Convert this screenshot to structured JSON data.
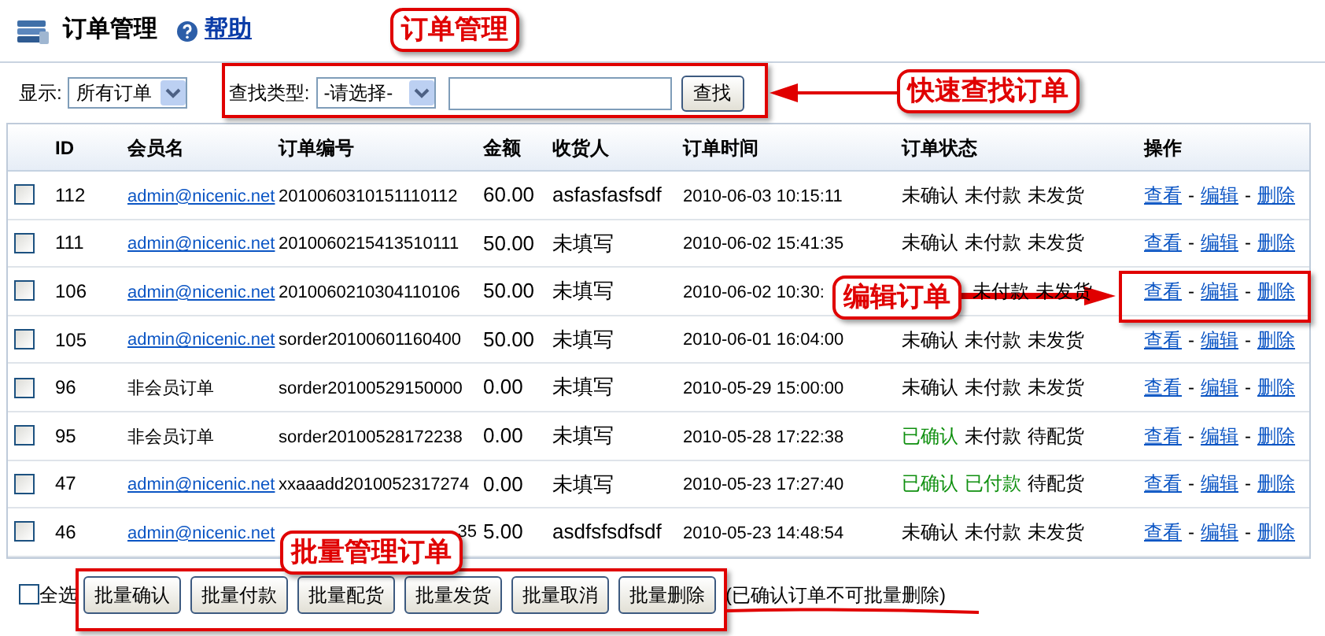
{
  "header": {
    "title": "订单管理",
    "help": "帮助"
  },
  "filter": {
    "label": "显示:",
    "value": "所有订单"
  },
  "search": {
    "type_label": "查找类型:",
    "type_value": "-请选择-",
    "button": "查找"
  },
  "table": {
    "columns": [
      "ID",
      "会员名",
      "订单编号",
      "金额",
      "收货人",
      "订单时间",
      "订单状态",
      "操作"
    ],
    "rows": [
      {
        "checked": false,
        "id": "112",
        "member": "admin@nicenic.net",
        "member_link": true,
        "order_no": "2010060310151110112",
        "amount": "60.00",
        "consignee": "asfasfasfsdf",
        "time": "2010-06-03 10:15:11",
        "status": [
          {
            "text": "未确认",
            "done": false
          },
          {
            "text": "未付款",
            "done": false
          },
          {
            "text": "未发货",
            "done": false
          }
        ],
        "actions": [
          {
            "kind": "link",
            "text": "查看"
          },
          {
            "kind": "sep",
            "text": "-"
          },
          {
            "kind": "link",
            "text": "编辑"
          },
          {
            "kind": "sep",
            "text": "-"
          },
          {
            "kind": "link",
            "text": "删除"
          }
        ]
      },
      {
        "checked": false,
        "id": "111",
        "member": "admin@nicenic.net",
        "member_link": true,
        "order_no": "2010060215413510111",
        "amount": "50.00",
        "consignee": "未填写",
        "time": "2010-06-02 15:41:35",
        "status": [
          {
            "text": "未确认",
            "done": false
          },
          {
            "text": "未付款",
            "done": false
          },
          {
            "text": "未发货",
            "done": false
          }
        ],
        "actions": [
          {
            "kind": "link",
            "text": "查看"
          },
          {
            "kind": "sep",
            "text": "-"
          },
          {
            "kind": "link",
            "text": "编辑"
          },
          {
            "kind": "sep",
            "text": "-"
          },
          {
            "kind": "link",
            "text": "删除"
          }
        ]
      },
      {
        "checked": false,
        "id": "106",
        "member": "admin@nicenic.net",
        "member_link": true,
        "order_no": "2010060210304110106",
        "amount": "50.00",
        "consignee": "未填写",
        "time": "2010-06-02 10:30:",
        "status": [
          {
            "text": "未付款",
            "done": false
          },
          {
            "text": "未发货",
            "done": false
          }
        ],
        "actions": [
          {
            "kind": "link",
            "text": "查看"
          },
          {
            "kind": "sep",
            "text": "-"
          },
          {
            "kind": "link",
            "text": "编辑"
          },
          {
            "kind": "sep",
            "text": "-"
          },
          {
            "kind": "link",
            "text": "删除"
          }
        ]
      },
      {
        "checked": false,
        "id": "105",
        "member": "admin@nicenic.net",
        "member_link": true,
        "order_no": "sorder20100601160400",
        "amount": "50.00",
        "consignee": "未填写",
        "time": "2010-06-01 16:04:00",
        "status": [
          {
            "text": "未确认",
            "done": false
          },
          {
            "text": "未付款",
            "done": false
          },
          {
            "text": "未发货",
            "done": false
          }
        ],
        "actions": [
          {
            "kind": "link",
            "text": "查看"
          },
          {
            "kind": "sep",
            "text": "-"
          },
          {
            "kind": "link",
            "text": "编辑"
          },
          {
            "kind": "sep",
            "text": "-"
          },
          {
            "kind": "link",
            "text": "删除"
          }
        ]
      },
      {
        "checked": false,
        "id": "96",
        "member": "非会员订单",
        "member_link": false,
        "order_no": "sorder20100529150000",
        "amount": "0.00",
        "consignee": "未填写",
        "time": "2010-05-29 15:00:00",
        "status": [
          {
            "text": "未确认",
            "done": false
          },
          {
            "text": "未付款",
            "done": false
          },
          {
            "text": "未发货",
            "done": false
          }
        ],
        "actions": [
          {
            "kind": "link",
            "text": "查看"
          },
          {
            "kind": "sep",
            "text": "-"
          },
          {
            "kind": "link",
            "text": "编辑"
          },
          {
            "kind": "sep",
            "text": "-"
          },
          {
            "kind": "link",
            "text": "删除"
          }
        ]
      },
      {
        "checked": false,
        "id": "95",
        "member": "非会员订单",
        "member_link": false,
        "order_no": "sorder20100528172238",
        "amount": "0.00",
        "consignee": "未填写",
        "time": "2010-05-28 17:22:38",
        "status": [
          {
            "text": "已确认",
            "done": true
          },
          {
            "text": "未付款",
            "done": false
          },
          {
            "text": "待配货",
            "done": false
          }
        ],
        "actions": [
          {
            "kind": "link",
            "text": "查看"
          },
          {
            "kind": "sep",
            "text": "-"
          },
          {
            "kind": "link",
            "text": "编辑"
          },
          {
            "kind": "sep",
            "text": "-"
          },
          {
            "kind": "link",
            "text": "删除"
          }
        ]
      },
      {
        "checked": false,
        "id": "47",
        "member": "admin@nicenic.net",
        "member_link": true,
        "order_no": "xxaaadd2010052317274",
        "amount": "0.00",
        "consignee": "未填写",
        "time": "2010-05-23 17:27:40",
        "status": [
          {
            "text": "已确认",
            "done": true
          },
          {
            "text": "已付款",
            "done": true
          },
          {
            "text": "待配货",
            "done": false
          }
        ],
        "actions": [
          {
            "kind": "link",
            "text": "查看"
          },
          {
            "kind": "sep",
            "text": "-"
          },
          {
            "kind": "link",
            "text": "编辑"
          },
          {
            "kind": "sep",
            "text": "-"
          },
          {
            "kind": "link",
            "text": "删除"
          }
        ]
      },
      {
        "checked": false,
        "id": "46",
        "member": "admin@nicenic.net",
        "member_link": true,
        "order_no": "35",
        "order_no_cut": true,
        "amount": "5.00",
        "consignee": "asdfsfsdfsdf",
        "time": "2010-05-23 14:48:54",
        "status": [
          {
            "text": "未确认",
            "done": false
          },
          {
            "text": "未付款",
            "done": false
          },
          {
            "text": "未发货",
            "done": false
          }
        ],
        "actions": [
          {
            "kind": "link",
            "text": "查看"
          },
          {
            "kind": "sep",
            "text": "-"
          },
          {
            "kind": "link",
            "text": "编辑"
          },
          {
            "kind": "sep",
            "text": "-"
          },
          {
            "kind": "link",
            "text": "删除"
          }
        ]
      }
    ]
  },
  "bulk": {
    "select_all": {
      "label": "全选",
      "checked": false
    },
    "buttons": [
      "批量确认",
      "批量付款",
      "批量配货",
      "批量发货",
      "批量取消",
      "批量删除"
    ],
    "note": "(已确认订单不可批量删除)"
  },
  "annotations": [
    {
      "kind": "label",
      "text": "订单管理"
    },
    {
      "kind": "search",
      "text": "快速查找订单"
    },
    {
      "kind": "edit",
      "text": "编辑订单"
    },
    {
      "kind": "bulk",
      "text": "批量管理订单"
    }
  ]
}
